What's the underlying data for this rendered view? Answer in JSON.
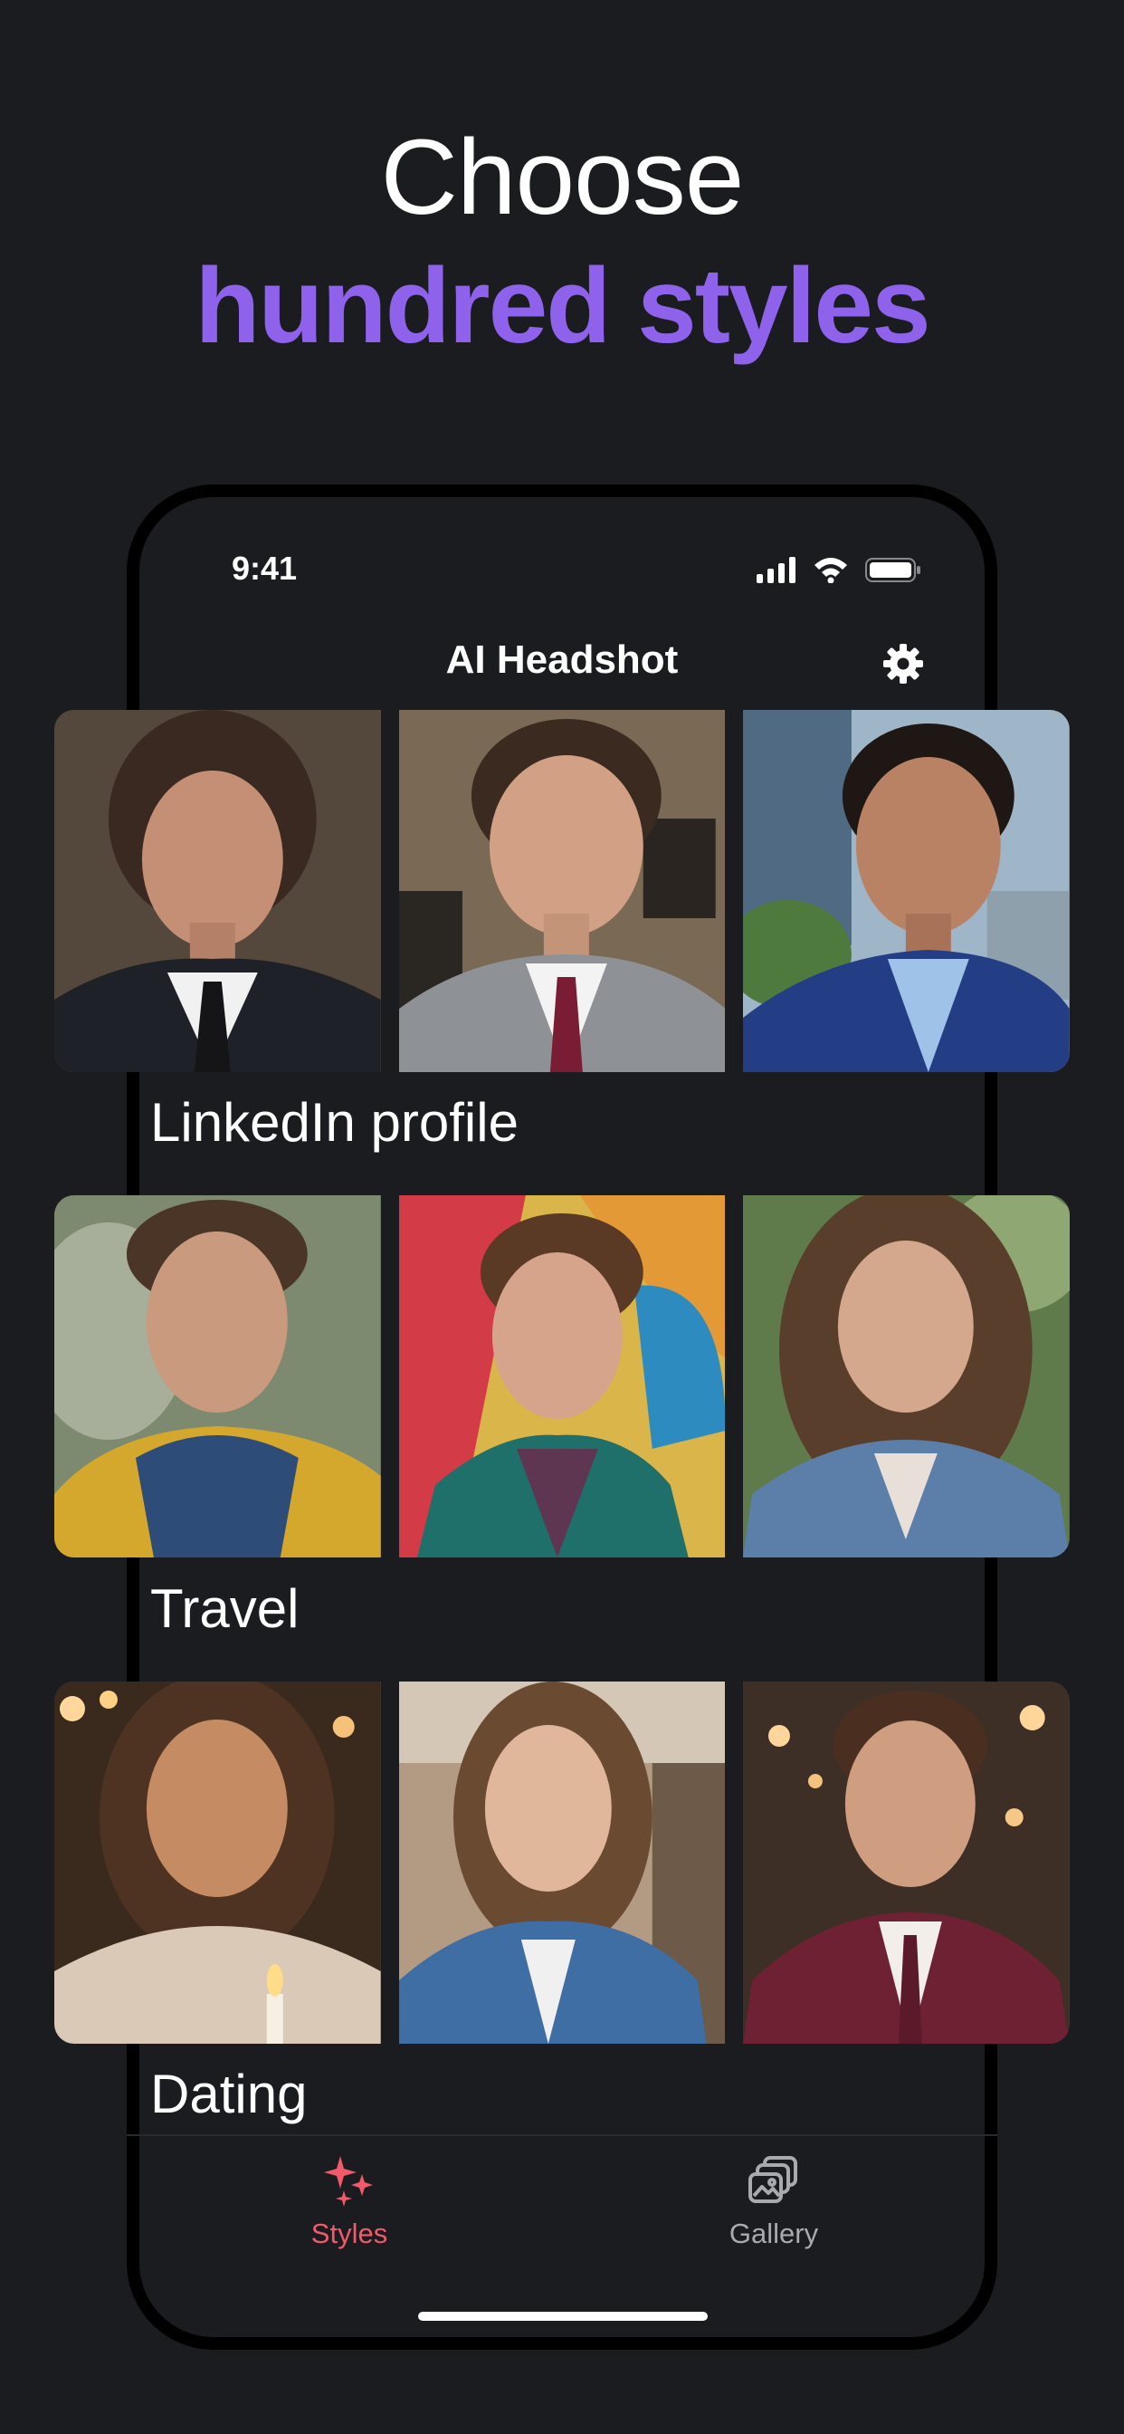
{
  "headline": {
    "line1": "Choose",
    "line2": "hundred styles"
  },
  "status_bar": {
    "time": "9:41"
  },
  "nav": {
    "title": "AI Headshot",
    "settings_icon": "gear-icon"
  },
  "sections": [
    {
      "label": "LinkedIn profile",
      "photo_count": 3
    },
    {
      "label": "Travel",
      "photo_count": 3
    },
    {
      "label": "Dating",
      "photo_count": 3
    }
  ],
  "tabbar": {
    "tabs": [
      {
        "label": "Styles",
        "icon": "sparkles-icon",
        "selected": true
      },
      {
        "label": "Gallery",
        "icon": "photo-stack-icon",
        "selected": false
      }
    ]
  },
  "colors": {
    "background": "#1b1c20",
    "accent_purple": "#8f62ec",
    "tab_active": "#f05a6a",
    "tab_inactive": "#a9aab0"
  }
}
